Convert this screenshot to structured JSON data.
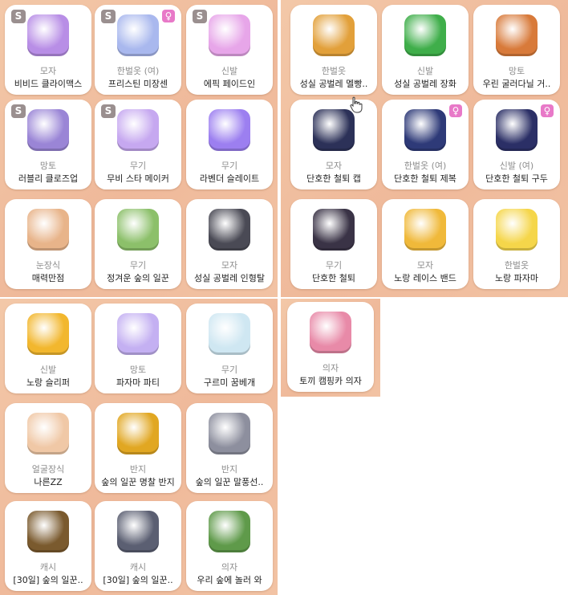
{
  "panels": [
    {
      "items": [
        {
          "cat": "모자",
          "name": "비비드 클라이맥스",
          "badge_s": "S",
          "badge_f": "",
          "icon": "purple-visor-icon",
          "color": "#b88ee6"
        },
        {
          "cat": "한벌옷 (여)",
          "name": "프리스틴 미장센",
          "badge_s": "S",
          "badge_f": "♀",
          "icon": "dress-icon",
          "color": "#a9b8ee"
        },
        {
          "cat": "신발",
          "name": "에픽 페이드인",
          "badge_s": "S",
          "badge_f": "",
          "icon": "sneaker-icon",
          "color": "#e7a6e9"
        },
        {
          "cat": "망토",
          "name": "러블리 클로즈업",
          "badge_s": "S",
          "badge_f": "",
          "icon": "camera-icon",
          "color": "#9a85d6"
        },
        {
          "cat": "무기",
          "name": "무비 스타 메이커",
          "badge_s": "S",
          "badge_f": "",
          "icon": "megaphone-icon",
          "color": "#c6a8f0"
        },
        {
          "cat": "무기",
          "name": "라벤더 슬레이트",
          "badge_s": "",
          "badge_f": "",
          "icon": "clapperboard-icon",
          "color": "#9c7ff0"
        },
        {
          "cat": "눈장식",
          "name": "매력만점",
          "badge_s": "",
          "badge_f": "",
          "icon": "eye-accessory-icon",
          "color": "#e8b48a"
        },
        {
          "cat": "무기",
          "name": "정겨운 숲의 일꾼",
          "badge_s": "",
          "badge_f": "",
          "icon": "rake-icon",
          "color": "#8cc06a"
        },
        {
          "cat": "모자",
          "name": "성실 공벌레 인형탈",
          "badge_s": "",
          "badge_f": "",
          "icon": "bug-hat-icon",
          "color": "#4a4a55"
        }
      ]
    },
    {
      "items": [
        {
          "cat": "한벌옷",
          "name": "성실 공벌레 멜빵..",
          "badge_s": "",
          "badge_f": "",
          "icon": "overall-icon",
          "color": "#e2a03a"
        },
        {
          "cat": "신발",
          "name": "성실 공벌레 장화",
          "badge_s": "",
          "badge_f": "",
          "icon": "boot-icon",
          "color": "#3fae4a"
        },
        {
          "cat": "망토",
          "name": "우린 굴러다닐 거..",
          "badge_s": "",
          "badge_f": "",
          "icon": "balls-icon",
          "color": "#d87a3a"
        },
        {
          "cat": "모자",
          "name": "단호한 철퇴 캡",
          "badge_s": "",
          "badge_f": "",
          "icon": "cap-icon",
          "color": "#2c3158"
        },
        {
          "cat": "한벌옷 (여)",
          "name": "단호한 철퇴 제복",
          "badge_s": "",
          "badge_f": "♀",
          "icon": "uniform-icon",
          "color": "#2e3a78"
        },
        {
          "cat": "신발 (여)",
          "name": "단호한 철퇴 구두",
          "badge_s": "",
          "badge_f": "♀",
          "icon": "shoe-icon",
          "color": "#2b2f66"
        },
        {
          "cat": "무기",
          "name": "단호한 철퇴",
          "badge_s": "",
          "badge_f": "",
          "icon": "mace-icon",
          "color": "#3a3346"
        },
        {
          "cat": "모자",
          "name": "노랑 레이스 밴드",
          "badge_s": "",
          "badge_f": "",
          "icon": "lace-band-icon",
          "color": "#f0b93a"
        },
        {
          "cat": "한벌옷",
          "name": "노랑 파자마",
          "badge_s": "",
          "badge_f": "",
          "icon": "pajama-icon",
          "color": "#f5d64a"
        }
      ]
    },
    {
      "items": [
        {
          "cat": "신발",
          "name": "노랑 슬리퍼",
          "badge_s": "",
          "badge_f": "",
          "icon": "slipper-icon",
          "color": "#f2b72e"
        },
        {
          "cat": "망토",
          "name": "파자마 파티",
          "badge_s": "",
          "badge_f": "",
          "icon": "moon-cape-icon",
          "color": "#c4b0f2"
        },
        {
          "cat": "무기",
          "name": "구르미 꿈베개",
          "badge_s": "",
          "badge_f": "",
          "icon": "cloud-pillow-icon",
          "color": "#cfe7f2"
        },
        {
          "cat": "얼굴장식",
          "name": "나른ZZ",
          "badge_s": "",
          "badge_f": "",
          "icon": "face-accessory-icon",
          "color": "#f0c8a6"
        },
        {
          "cat": "반지",
          "name": "숲의 일꾼 명찰 반지",
          "badge_s": "",
          "badge_f": "",
          "icon": "gold-ring-icon",
          "color": "#e1a722"
        },
        {
          "cat": "반지",
          "name": "숲의 일꾼 말풍선..",
          "badge_s": "",
          "badge_f": "",
          "icon": "silver-ring-icon",
          "color": "#8d8f9e"
        },
        {
          "cat": "캐시",
          "name": "[30일] 숲의 일꾼..",
          "badge_s": "",
          "badge_f": "",
          "icon": "gold-nametag-icon",
          "color": "#7a5a2e"
        },
        {
          "cat": "캐시",
          "name": "[30일] 숲의 일꾼..",
          "badge_s": "",
          "badge_f": "",
          "icon": "silver-nametag-icon",
          "color": "#5b5f72"
        },
        {
          "cat": "의자",
          "name": "우리 숲에 놀러 와",
          "badge_s": "",
          "badge_f": "",
          "icon": "forest-chair-icon",
          "color": "#5f9a4a"
        }
      ]
    },
    {
      "items": [
        {
          "cat": "의자",
          "name": "토끼 캠핑카 의자",
          "badge_s": "",
          "badge_f": "",
          "icon": "camper-chair-icon",
          "color": "#e88aa8"
        }
      ]
    }
  ]
}
